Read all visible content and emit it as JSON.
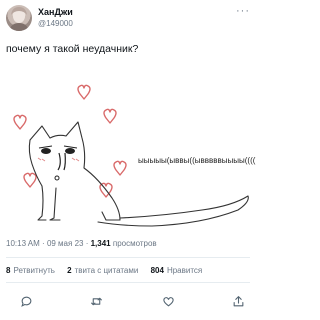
{
  "author": {
    "display_name": "ХанДжи",
    "handle": "@149000"
  },
  "more_icon": "more-horizontal-icon",
  "tweet_text": "почему я такой неудачник?",
  "image_caption": "ыыыыы(ыввы((ывввввыыыы((((",
  "meta": {
    "time": "10:13 AM",
    "date": "09 мая 23",
    "views_count": "1,341",
    "views_label": "просмотров"
  },
  "stats": {
    "retweets_count": "8",
    "retweets_label": "Ретвитнуть",
    "quotes_count": "2",
    "quotes_label": "твита с цитатами",
    "likes_count": "804",
    "likes_label": "Нравится"
  },
  "actions": [
    {
      "name": "reply-icon"
    },
    {
      "name": "retweet-icon"
    },
    {
      "name": "like-icon"
    },
    {
      "name": "share-icon"
    }
  ],
  "colors": {
    "text": "#0f1419",
    "secondary": "#6b7785",
    "heart": "#d96a6a",
    "divider": "#e6ecf0"
  }
}
